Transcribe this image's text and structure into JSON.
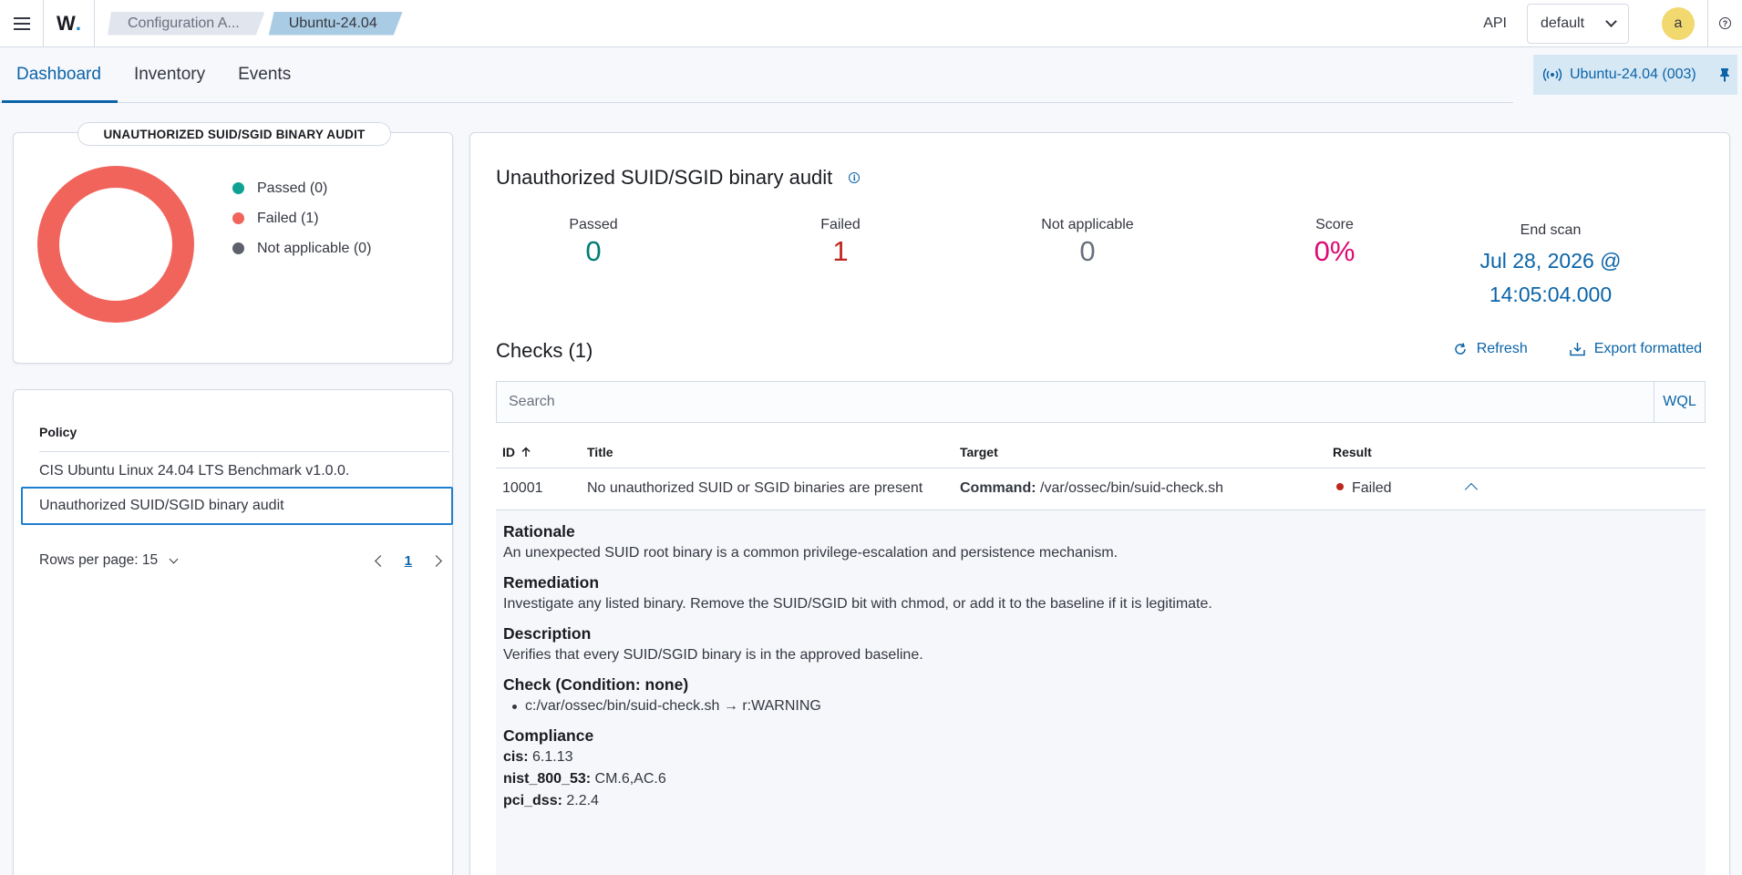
{
  "header": {
    "logo_text": "W",
    "logo_dot": ".",
    "breadcrumbs": [
      "Configuration A...",
      "Ubuntu-24.04"
    ],
    "api_label": "API",
    "space_select": "default",
    "avatar_initial": "a"
  },
  "tabs": [
    {
      "label": "Dashboard",
      "active": true
    },
    {
      "label": "Inventory",
      "active": false
    },
    {
      "label": "Events",
      "active": false
    }
  ],
  "agent_badge": "Ubuntu-24.04 (003)",
  "summary_chart": {
    "title": "UNAUTHORIZED SUID/SGID BINARY AUDIT",
    "legend": [
      {
        "label": "Passed (0)",
        "color": "#0fa192"
      },
      {
        "label": "Failed (1)",
        "color": "#f0645c"
      },
      {
        "label": "Not applicable (0)",
        "color": "#5d616c"
      }
    ]
  },
  "chart_data": {
    "type": "pie",
    "title": "UNAUTHORIZED SUID/SGID BINARY AUDIT",
    "categories": [
      "Passed",
      "Failed",
      "Not applicable"
    ],
    "values": [
      0,
      1,
      0
    ],
    "colors": [
      "#0fa192",
      "#f0645c",
      "#5d616c"
    ],
    "donut": true,
    "legend_position": "right"
  },
  "policy_table": {
    "header": "Policy",
    "rows": [
      "CIS Ubuntu Linux 24.04 LTS Benchmark v1.0.0.",
      "Unauthorized SUID/SGID binary audit"
    ],
    "rows_per_page_label": "Rows per page: 15",
    "current_page": "1"
  },
  "main": {
    "title": "Unauthorized SUID/SGID binary audit",
    "stats": [
      {
        "label": "Passed",
        "value": "0",
        "color": "#017d73"
      },
      {
        "label": "Failed",
        "value": "1",
        "color": "#bd271e"
      },
      {
        "label": "Not applicable",
        "value": "0",
        "color": "#69707d"
      },
      {
        "label": "Score",
        "value": "0%",
        "color": "#dd0a73"
      }
    ],
    "end_scan_label": "End scan",
    "end_scan_value_line1": "Jul 28, 2026 @",
    "end_scan_value_line2": "14:05:04.000",
    "checks_title": "Checks (1)",
    "refresh_label": "Refresh",
    "export_label": "Export formatted",
    "search_placeholder": "Search",
    "wql_label": "WQL",
    "columns": [
      "ID",
      "Title",
      "Target",
      "Result"
    ],
    "row": {
      "id": "10001",
      "title": "No unauthorized SUID or SGID binaries are present",
      "target_label": "Command:",
      "target_value": " /var/ossec/bin/suid-check.sh",
      "result": "Failed"
    },
    "details": {
      "rationale_head": "Rationale",
      "rationale": "An unexpected SUID root binary is a common privilege-escalation and persistence mechanism.",
      "remediation_head": "Remediation",
      "remediation": "Investigate any listed binary. Remove the SUID/SGID bit with chmod, or add it to the baseline if it is legitimate.",
      "description_head": "Description",
      "description": "Verifies that every SUID/SGID binary is in the approved baseline.",
      "check_head": "Check (Condition: none)",
      "check_item": "c:/var/ossec/bin/suid-check.sh → r:WARNING",
      "compliance_head": "Compliance",
      "compliance": [
        {
          "key": "cis:",
          "value": " 6.1.13"
        },
        {
          "key": "nist_800_53:",
          "value": " CM.6,AC.6"
        },
        {
          "key": "pci_dss:",
          "value": " 2.2.4"
        }
      ]
    }
  }
}
